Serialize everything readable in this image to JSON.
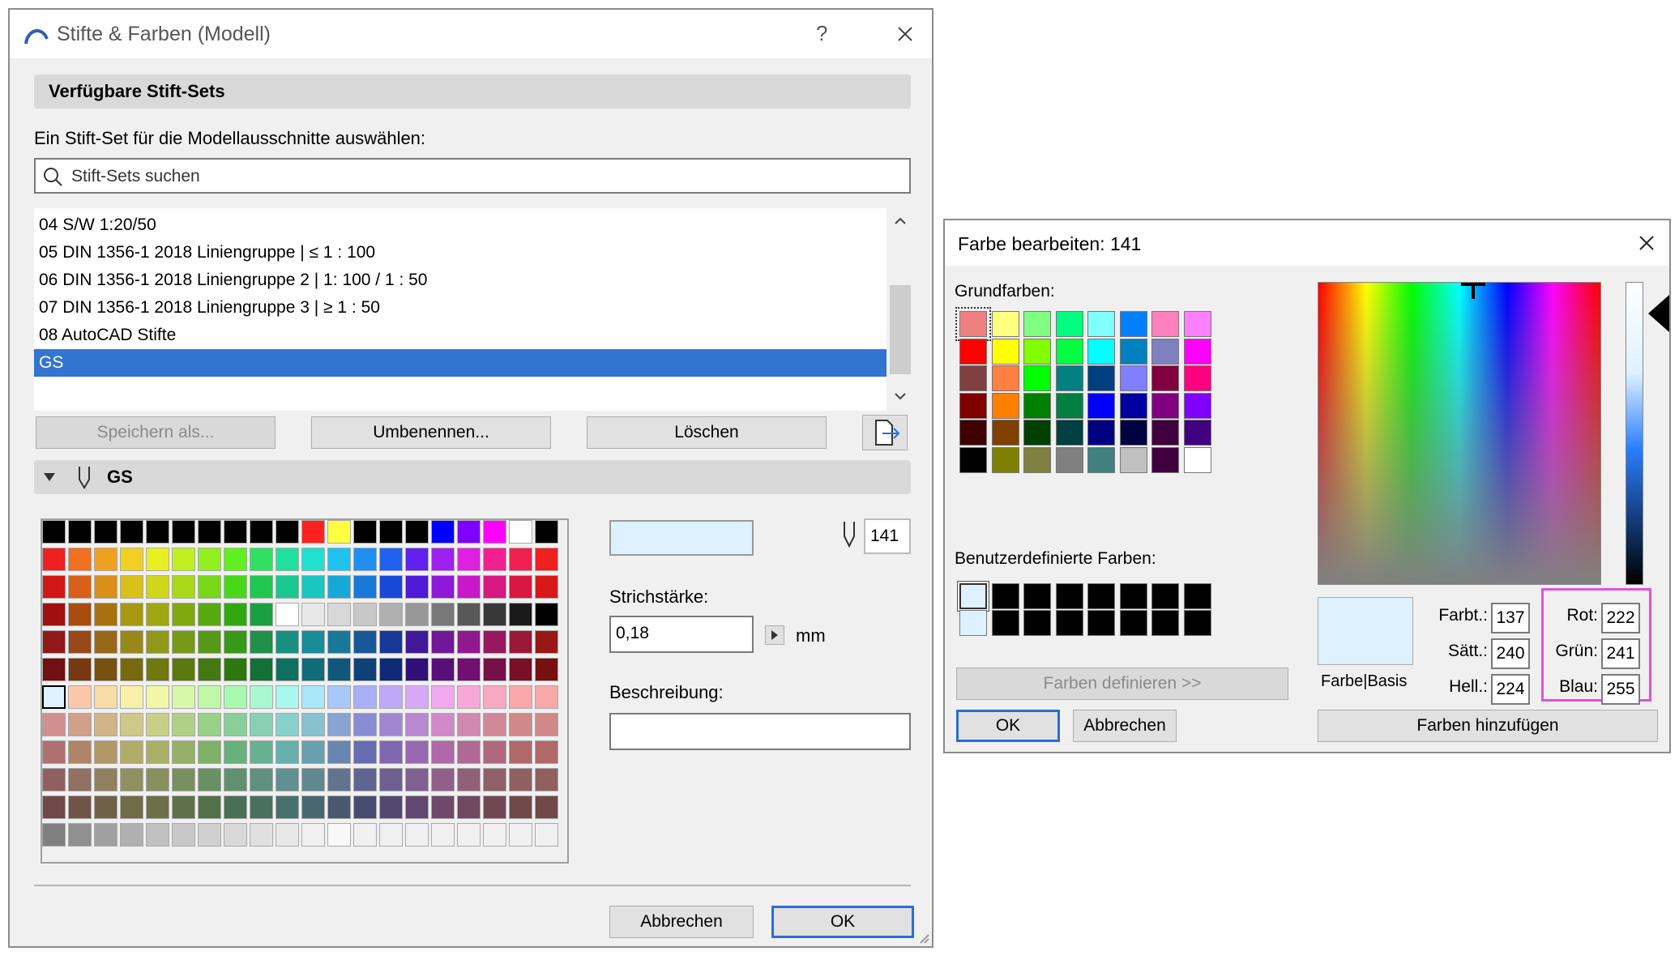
{
  "dialog1": {
    "title": "Stifte & Farben (Modell)",
    "help_label": "?",
    "section_available": "Verfügbare Stift-Sets",
    "choose_label": "Ein Stift-Set für die Modellausschnitte auswählen:",
    "search_placeholder": "Stift-Sets suchen",
    "pen_sets": [
      "04 S/W 1:20/50",
      "05 DIN 1356-1 2018 Liniengruppe | ≤ 1 : 100",
      "06 DIN 1356-1 2018 Liniengruppe 2 | 1: 100 / 1 : 50",
      "07 DIN 1356-1 2018 Liniengruppe 3 | ≥ 1 : 50",
      "08 AutoCAD Stifte",
      "GS"
    ],
    "selected_pen_set": "GS",
    "buttons": {
      "save_as": "Speichern als...",
      "rename": "Umbenennen...",
      "delete": "Löschen",
      "cancel": "Abbrechen",
      "ok": "OK"
    },
    "set_name": "GS",
    "pen_number": "141",
    "line_weight_label": "Strichstärke:",
    "line_weight_value": "0,18",
    "unit": "mm",
    "description_label": "Beschreibung:",
    "description_value": ""
  },
  "dialog2": {
    "title": "Farbe bearbeiten:  141",
    "basic_colors_label": "Grundfarben:",
    "custom_colors_label": "Benutzerdefinierte Farben:",
    "define_colors": "Farben definieren >>",
    "ok": "OK",
    "cancel": "Abbrechen",
    "add_colors": "Farben hinzufügen",
    "preview_label": "Farbe|Basis",
    "hue_label": "Farbt.:",
    "hue_value": "137",
    "sat_label": "Sätt.:",
    "sat_value": "240",
    "lum_label": "Hell.:",
    "lum_value": "224",
    "red_label": "Rot:",
    "red_value": "222",
    "green_label": "Grün:",
    "green_value": "241",
    "blue_label": "Blau:",
    "blue_value": "255",
    "basic_colors": [
      "#f08080",
      "#ffff80",
      "#80ff80",
      "#00ff80",
      "#80ffff",
      "#0080ff",
      "#ff80c0",
      "#ff80ff",
      "#ff0000",
      "#ffff00",
      "#80ff00",
      "#00ff40",
      "#00ffff",
      "#0080c0",
      "#8080c0",
      "#ff00ff",
      "#804040",
      "#ff8040",
      "#00ff00",
      "#008080",
      "#004080",
      "#8080ff",
      "#800040",
      "#ff0080",
      "#800000",
      "#ff8000",
      "#008000",
      "#008040",
      "#0000ff",
      "#0000a0",
      "#800080",
      "#8000ff",
      "#400000",
      "#804000",
      "#004000",
      "#004040",
      "#000080",
      "#000040",
      "#400040",
      "#400080",
      "#000000",
      "#808000",
      "#808040",
      "#808080",
      "#408080",
      "#c0c0c0",
      "#400040",
      "#ffffff"
    ],
    "custom_colors": [
      "#def1ff",
      "#000000",
      "#000000",
      "#000000",
      "#000000",
      "#000000",
      "#000000",
      "#000000",
      "#def1ff",
      "#000000",
      "#000000",
      "#000000",
      "#000000",
      "#000000",
      "#000000",
      "#000000"
    ]
  },
  "pen_palette_rows": [
    [
      "#000000",
      "#000000",
      "#000000",
      "#000000",
      "#000000",
      "#000000",
      "#000000",
      "#000000",
      "#000000",
      "#000000",
      "#ff2020",
      "#ffff40",
      "#000000",
      "#000000",
      "#000000",
      "#0000ff",
      "#8000ff",
      "#ff00ff",
      "#ffffff",
      "#000000"
    ],
    [
      "#ee2020",
      "#f07020",
      "#f0a020",
      "#f0d020",
      "#e8f020",
      "#c0f020",
      "#90f020",
      "#60f020",
      "#30e060",
      "#20e0a0",
      "#20e0d0",
      "#20c0f0",
      "#2090f0",
      "#2060f0",
      "#6020f0",
      "#a020f0",
      "#e020e0",
      "#f02090",
      "#f02050",
      "#f02020"
    ],
    [
      "#d01818",
      "#d86018",
      "#d89018",
      "#d8c018",
      "#cfd818",
      "#a8d818",
      "#78d818",
      "#48d818",
      "#20c850",
      "#18c890",
      "#18c8c0",
      "#18a8d8",
      "#1878d8",
      "#1848d8",
      "#5018d8",
      "#9018d8",
      "#c818c8",
      "#d81880",
      "#d81840",
      "#d81818"
    ],
    [
      "#a01010",
      "#a84c10",
      "#a87010",
      "#a89810",
      "#9ea810",
      "#80a810",
      "#58a810",
      "#30a810",
      "#18a040",
      "#ffffff",
      "#e8e8e8",
      "#d8d8d8",
      "#c8c8c8",
      "#b0b0b0",
      "#989898",
      "#787878",
      "#585858",
      "#383838",
      "#1a1a1a",
      "#000000"
    ],
    [
      "#901818",
      "#984818",
      "#986818",
      "#988818",
      "#909818",
      "#789818",
      "#589818",
      "#389818",
      "#20904a",
      "#189080",
      "#188c98",
      "#187898",
      "#185898",
      "#183898",
      "#401898",
      "#701898",
      "#901890",
      "#981860",
      "#981838",
      "#981818"
    ],
    [
      "#701010",
      "#783810",
      "#785010",
      "#786810",
      "#707810",
      "#5c7810",
      "#447810",
      "#2c7810",
      "#147038",
      "#107060",
      "#106c78",
      "#105878",
      "#104078",
      "#102878",
      "#301078",
      "#581078",
      "#701070",
      "#781048",
      "#781028",
      "#781010"
    ],
    [
      "#f5c0c0",
      "#f8c8a8",
      "#f8dca8",
      "#f8f0a8",
      "#f0f8a8",
      "#d8f8a8",
      "#c0f8a8",
      "#a8f8b0",
      "#a8f8d0",
      "#a8f8f0",
      "#a8e8f8",
      "#a8c8f8",
      "#a8b0f8",
      "#c0a8f8",
      "#d8a8f8",
      "#f0a8f0",
      "#f8a8d8",
      "#f8a8c0",
      "#f8a8a8",
      "#f8a8a8"
    ],
    [
      "#d09090",
      "#d0a088",
      "#d0b488",
      "#d0c888",
      "#c8d088",
      "#b0d088",
      "#98d088",
      "#88d098",
      "#88d0b4",
      "#88d0cc",
      "#88c0d0",
      "#88a4d0",
      "#888cd0",
      "#a088d0",
      "#b888d0",
      "#d088c8",
      "#d088b0",
      "#d08898",
      "#d08888",
      "#d08888"
    ],
    [
      "#b07070",
      "#b08468",
      "#b09868",
      "#b0ac68",
      "#a8b068",
      "#94b068",
      "#80b068",
      "#68b07c",
      "#68b094",
      "#68b0ac",
      "#68a0b0",
      "#6884b0",
      "#686cb0",
      "#8068b0",
      "#9868b0",
      "#b068a8",
      "#b06894",
      "#b0687c",
      "#b06868",
      "#b06868"
    ],
    [
      "#906060",
      "#907060",
      "#908060",
      "#909060",
      "#889060",
      "#789060",
      "#689060",
      "#609070",
      "#609080",
      "#609090",
      "#608890",
      "#607490",
      "#606490",
      "#706090",
      "#806090",
      "#906088",
      "#906078",
      "#906068",
      "#906060",
      "#906060"
    ],
    [
      "#704848",
      "#705448",
      "#706048",
      "#706c48",
      "#6c7048",
      "#607048",
      "#547048",
      "#487054",
      "#487060",
      "#48706c",
      "#486870",
      "#485870",
      "#484c70",
      "#544870",
      "#604870",
      "#70486c",
      "#704860",
      "#704854",
      "#704848",
      "#704848"
    ],
    [
      "#808080",
      "#909090",
      "#a0a0a0",
      "#b0b0b0",
      "#c0c0c0",
      "#c8c8c8",
      "#d0d0d0",
      "#d8d8d8",
      "#e0e0e0",
      "#e8e8e8",
      "#f0f0f0",
      "#f8f8f8",
      "#f0f0f0",
      "#f0f0f0",
      "#f0f0f0",
      "#f0f0f0",
      "#f0f0f0",
      "#f0f0f0",
      "#f0f0f0",
      "#f0f0f0"
    ]
  ]
}
